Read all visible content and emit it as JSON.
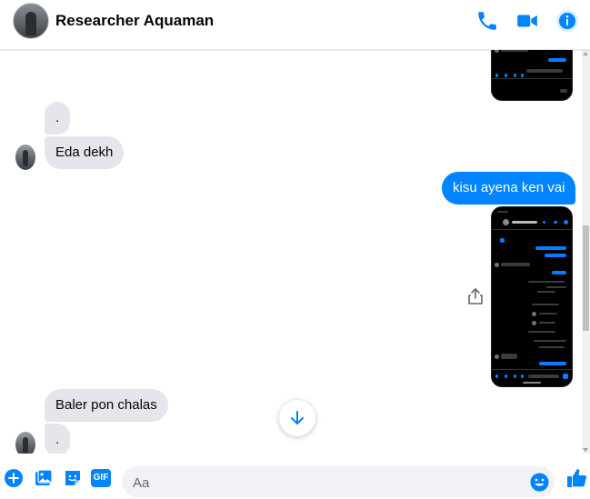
{
  "header": {
    "contact_name": "Researcher Aquaman",
    "icons": [
      "phone-icon",
      "video-camera-icon",
      "info-icon"
    ]
  },
  "colors": {
    "accent": "#0084ff",
    "incoming_bubble": "#e4e6eb",
    "text": "#050505"
  },
  "messages": {
    "in_1": ".",
    "in_2": "Eda dekh",
    "out_1": "kisu ayena ken vai",
    "in_3": "Baler pon chalas",
    "in_4": "."
  },
  "composer": {
    "placeholder": "Aa",
    "icons": [
      "plus-icon",
      "image-icon",
      "sticker-icon",
      "gif-icon",
      "emoji-icon",
      "thumbs-up-icon"
    ],
    "gif_label": "GIF"
  }
}
